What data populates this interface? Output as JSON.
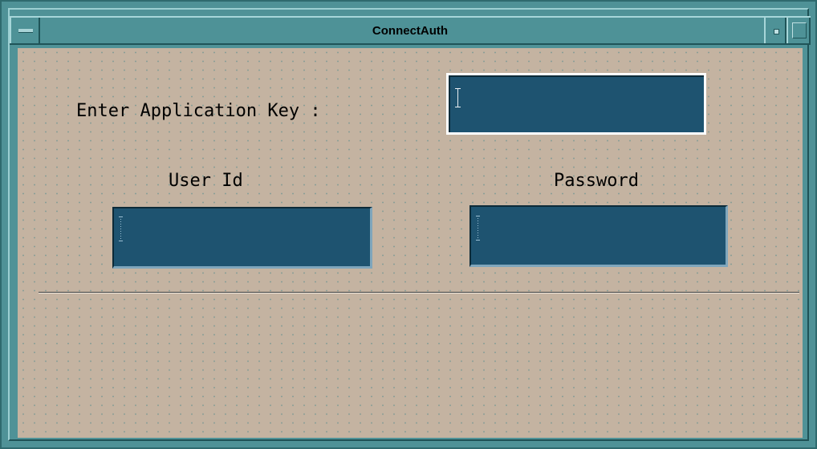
{
  "window": {
    "title": "ConnectAuth",
    "icons": {
      "window_menu": "window-menu-icon",
      "minimize": "minimize-icon",
      "maximize": "maximize-icon"
    }
  },
  "form": {
    "app_key_label": "Enter Application Key :",
    "app_key_value": "",
    "user_id_label": "User Id",
    "user_id_value": "",
    "password_label": "Password",
    "password_value": ""
  },
  "colors": {
    "frame": "#4f9297",
    "client_background": "#c4b3a1",
    "field_background": "#1e5370",
    "focus_border": "#ffffff"
  }
}
